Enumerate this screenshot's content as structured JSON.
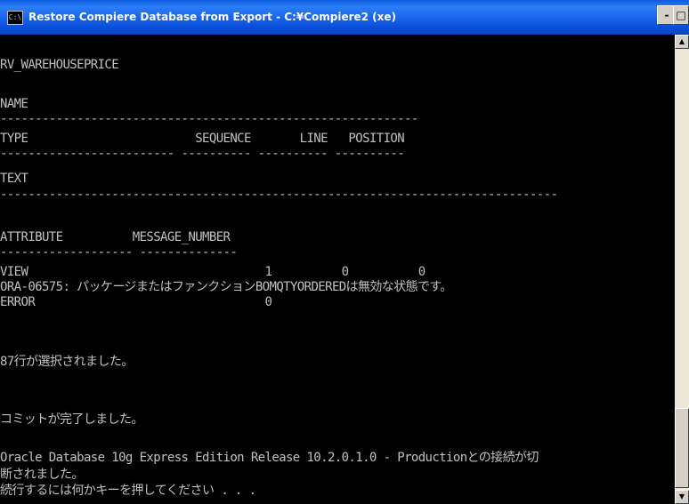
{
  "window": {
    "title": "Restore Compiere Database from Export - C:¥Compiere2 (xe)",
    "system_icon": "console-icon",
    "controls": {
      "minimize": "-",
      "maximize": "□"
    }
  },
  "console": {
    "lines": [
      "RV_WAREHOUSEPRICE",
      "",
      "NAME",
      "------------------------------------------------------------",
      "TYPE                        SEQUENCE       LINE   POSITION",
      "------------------------- ---------- ---------- ----------",
      "TEXT",
      "--------------------------------------------------------------------------------",
      "",
      "ATTRIBUTE          MESSAGE_NUMBER",
      "------------------- --------------",
      "VIEW                                  1          0          0",
      "ORA-06575: パッケージまたはファンクションBOMQTYORDEREDは無効な状態です。",
      "ERROR                                 0",
      "",
      "",
      "87行が選択されました。",
      "",
      "",
      "コミットが完了しました。",
      "",
      "Oracle Database 10g Express Edition Release 10.2.0.1.0 - Productionとの接続が切",
      "断されました。",
      "続行するには何かキーを押してください . . ."
    ]
  },
  "scrollbar": {
    "up_icon": "scroll-up-arrow-icon",
    "down_icon": "scroll-down-arrow-icon"
  }
}
